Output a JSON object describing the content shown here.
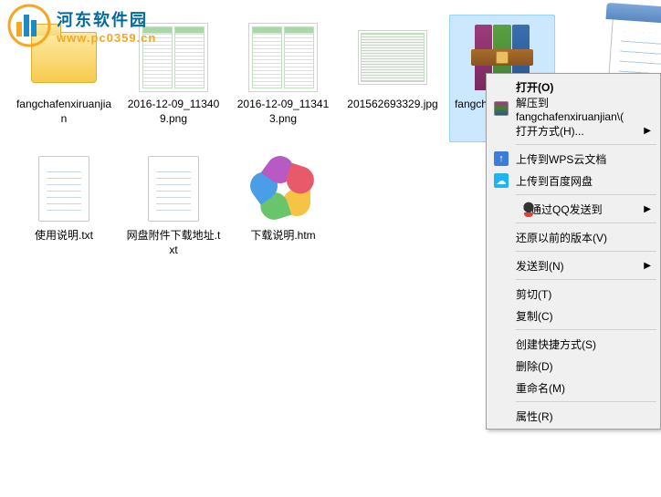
{
  "watermark": {
    "title": "河东软件园",
    "url": "www.pc0359.cn"
  },
  "files": [
    {
      "name": "fangchafenxiruanjian",
      "type": "folder"
    },
    {
      "name": "2016-12-09_113409.png",
      "type": "spreadsheet-png"
    },
    {
      "name": "2016-12-09_113413.png",
      "type": "spreadsheet-png"
    },
    {
      "name": "201562693329.jpg",
      "type": "spreadsheet-jpg"
    },
    {
      "name": "fangchafenxiruanjian.r",
      "type": "rar",
      "selected": true
    },
    {
      "name": "notepad",
      "type": "notepad-corner"
    },
    {
      "name": "使用说明.txt",
      "type": "txt"
    },
    {
      "name": "网盘附件下载地址.txt",
      "type": "txt"
    },
    {
      "name": "下载说明.htm",
      "type": "htm"
    }
  ],
  "contextMenu": {
    "items": [
      {
        "label": "打开(O)",
        "bold": true
      },
      {
        "label": "解压到 fangchafenxiruanjian\\(",
        "icon": "rar"
      },
      {
        "label": "打开方式(H)...",
        "submenu": true
      },
      {
        "sep": true
      },
      {
        "label": "上传到WPS云文档",
        "icon": "wps"
      },
      {
        "label": "上传到百度网盘",
        "icon": "baidu"
      },
      {
        "sep": true
      },
      {
        "label": "通过QQ发送到",
        "icon": "qq",
        "submenu": true
      },
      {
        "sep": true
      },
      {
        "label": "还原以前的版本(V)"
      },
      {
        "sep": true
      },
      {
        "label": "发送到(N)",
        "submenu": true
      },
      {
        "sep": true
      },
      {
        "label": "剪切(T)"
      },
      {
        "label": "复制(C)"
      },
      {
        "sep": true
      },
      {
        "label": "创建快捷方式(S)"
      },
      {
        "label": "删除(D)"
      },
      {
        "label": "重命名(M)"
      },
      {
        "sep": true
      },
      {
        "label": "属性(R)"
      }
    ]
  }
}
